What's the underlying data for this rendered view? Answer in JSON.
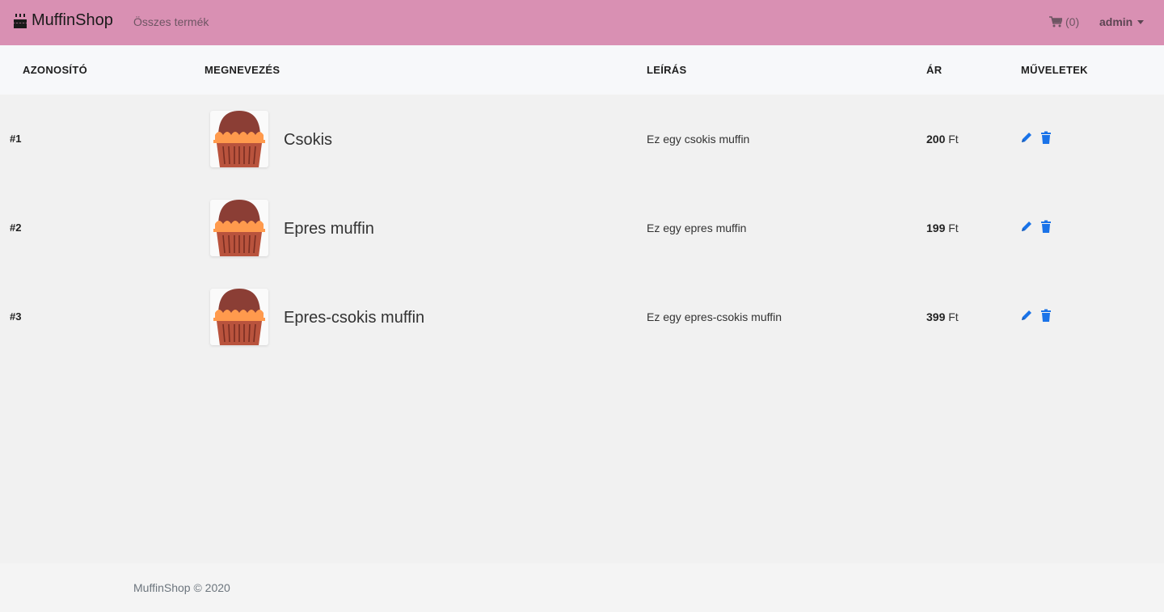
{
  "navbar": {
    "brand": "MuffinShop",
    "link_all_products": "Összes termék",
    "cart_count": "(0)",
    "user": "admin",
    "background_color": "#d990b3"
  },
  "table": {
    "headers": {
      "id": "AZONOSÍTÓ",
      "name": "MEGNEVEZÉS",
      "description": "LEÍRÁS",
      "price": "ÁR",
      "actions": "MŰVELETEK"
    },
    "rows": [
      {
        "id": "#1",
        "name": "Csokis",
        "description": "Ez egy csokis muffin",
        "price": "200",
        "currency": "Ft"
      },
      {
        "id": "#2",
        "name": "Epres muffin",
        "description": "Ez egy epres muffin",
        "price": "199",
        "currency": "Ft"
      },
      {
        "id": "#3",
        "name": "Epres-csokis muffin",
        "description": "Ez egy epres-csokis muffin",
        "price": "399",
        "currency": "Ft"
      }
    ]
  },
  "icons": {
    "brand": "birthday-cake-icon",
    "cart": "shopping-cart-icon",
    "edit": "pencil-icon",
    "delete": "trash-icon",
    "product": "muffin-image"
  },
  "colors": {
    "action_blue": "#1a73e8",
    "muffin_top": "#8b3e35",
    "muffin_cream": "#ff9a4d",
    "muffin_cup": "#b9533d"
  },
  "footer": {
    "text": "MuffinShop © 2020"
  }
}
